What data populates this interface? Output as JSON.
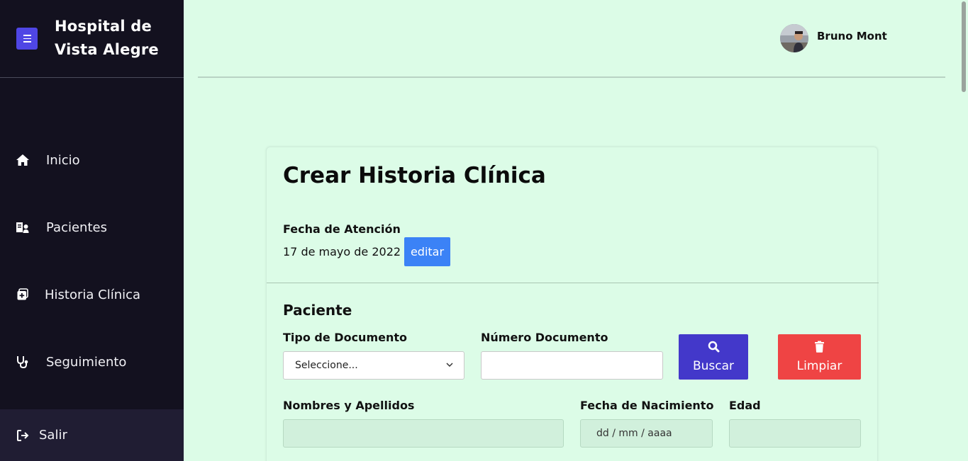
{
  "sidebar": {
    "brand_title": "Hospital de Vista Alegre",
    "items": [
      {
        "label": "Inicio",
        "icon": "home-icon"
      },
      {
        "label": "Pacientes",
        "icon": "patients-icon"
      },
      {
        "label": "Historia Clínica",
        "icon": "medical-record-icon"
      },
      {
        "label": "Seguimiento",
        "icon": "stethoscope-icon"
      }
    ],
    "logout_label": "Salir"
  },
  "header": {
    "user_name": "Bruno Mont"
  },
  "form": {
    "title": "Crear Historia Clínica",
    "attention_date_label": "Fecha de Atención",
    "attention_date_value": "17 de mayo de 2022",
    "edit_label": "editar",
    "section_patient": "Paciente",
    "doc_type_label": "Tipo de Documento",
    "doc_type_value": "Seleccione...",
    "doc_number_label": "Número Documento",
    "search_label": "Buscar",
    "clear_label": "Limpiar",
    "fullname_label": "Nombres y Apellidos",
    "birthdate_label": "Fecha de Nacimiento",
    "birthdate_placeholder": "dd / mm / aaaa",
    "age_label": "Edad"
  },
  "colors": {
    "sidebar_bg": "#13111f",
    "page_bg": "#dcfce7",
    "accent_blue": "#3b82f6",
    "accent_indigo": "#4338ca",
    "danger": "#ef4444"
  }
}
